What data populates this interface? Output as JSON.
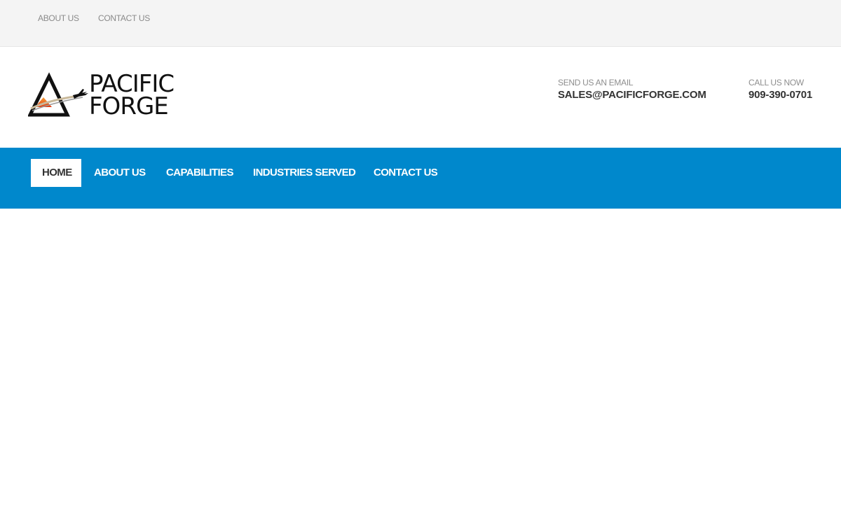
{
  "top_links": {
    "about": "ABOUT US",
    "contact": "CONTACT US"
  },
  "logo": {
    "line1": "PACIFIC",
    "line2": "FORGE",
    "icon": "triangle-jet-logo"
  },
  "contact": {
    "email_label": "SEND US AN EMAIL",
    "email": "SALES@PACIFICFORGE.COM",
    "phone_label": "CALL US NOW",
    "phone": "909-390-0701"
  },
  "nav": {
    "items": [
      {
        "label": "HOME",
        "active": true
      },
      {
        "label": "ABOUT US",
        "active": false
      },
      {
        "label": "CAPABILITIES",
        "active": false
      },
      {
        "label": "INDUSTRIES SERVED",
        "active": false
      },
      {
        "label": "CONTACT US",
        "active": false
      }
    ]
  },
  "colors": {
    "nav_background": "#0088cc",
    "top_bar_background": "#f4f4f4",
    "logo_accent": "#e8501e"
  }
}
